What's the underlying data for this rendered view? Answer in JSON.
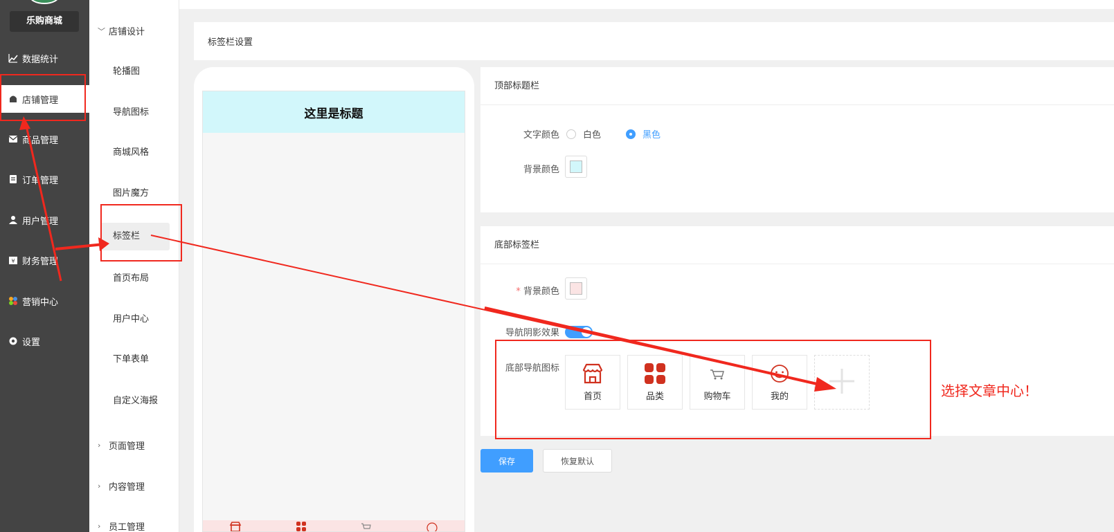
{
  "app": {
    "brand": "乐购商城"
  },
  "sidebar": {
    "items": [
      {
        "label": "数据统计",
        "icon": "chart-line-icon"
      },
      {
        "label": "店铺管理",
        "icon": "store-icon",
        "active": true
      },
      {
        "label": "商品管理",
        "icon": "product-box-icon"
      },
      {
        "label": "订单管理",
        "icon": "order-clipboard-icon"
      },
      {
        "label": "用户管理",
        "icon": "user-icon"
      },
      {
        "label": "财务管理",
        "icon": "finance-icon"
      },
      {
        "label": "营销中心",
        "icon": "marketing-icon"
      },
      {
        "label": "设置",
        "icon": "gear-icon"
      }
    ]
  },
  "submenu": {
    "group_store_design": "店铺设计",
    "items": [
      "轮播图",
      "导航图标",
      "商城风格",
      "图片魔方",
      "标签栏",
      "首页布局",
      "用户中心",
      "下单表单",
      "自定义海报"
    ],
    "active_item": "标签栏",
    "group_page": "页面管理",
    "group_content": "内容管理",
    "group_staff": "员工管理"
  },
  "main": {
    "panel_title": "标签栏设置"
  },
  "preview": {
    "header_title": "这里是标题"
  },
  "top_bar_settings": {
    "title": "顶部标题栏",
    "text_color_label": "文字颜色",
    "text_color_options": [
      "白色",
      "黑色"
    ],
    "text_color_selected": "黑色",
    "bg_color_label": "背景颜色",
    "bg_color": "#d2f7fb"
  },
  "bottom_bar_settings": {
    "title": "底部标签栏",
    "required_mark": "*",
    "bg_color_label": "背景颜色",
    "bg_color": "#fbe4e4",
    "shadow_label": "导航阴影效果",
    "shadow_enabled": true,
    "icons_label": "底部导航图标",
    "icons": [
      {
        "label": "首页",
        "icon": "home-store-icon"
      },
      {
        "label": "品类",
        "icon": "category-grid-icon"
      },
      {
        "label": "购物车",
        "icon": "cart-icon"
      },
      {
        "label": "我的",
        "icon": "profile-face-icon"
      }
    ]
  },
  "actions": {
    "save_label": "保存",
    "reset_label": "恢复默认"
  },
  "annotation": {
    "text": "选择文章中心！",
    "color": "#f0281e"
  },
  "colors": {
    "primary": "#409eff",
    "sidebar_bg": "#444444",
    "icon_red": "#d0311f"
  }
}
